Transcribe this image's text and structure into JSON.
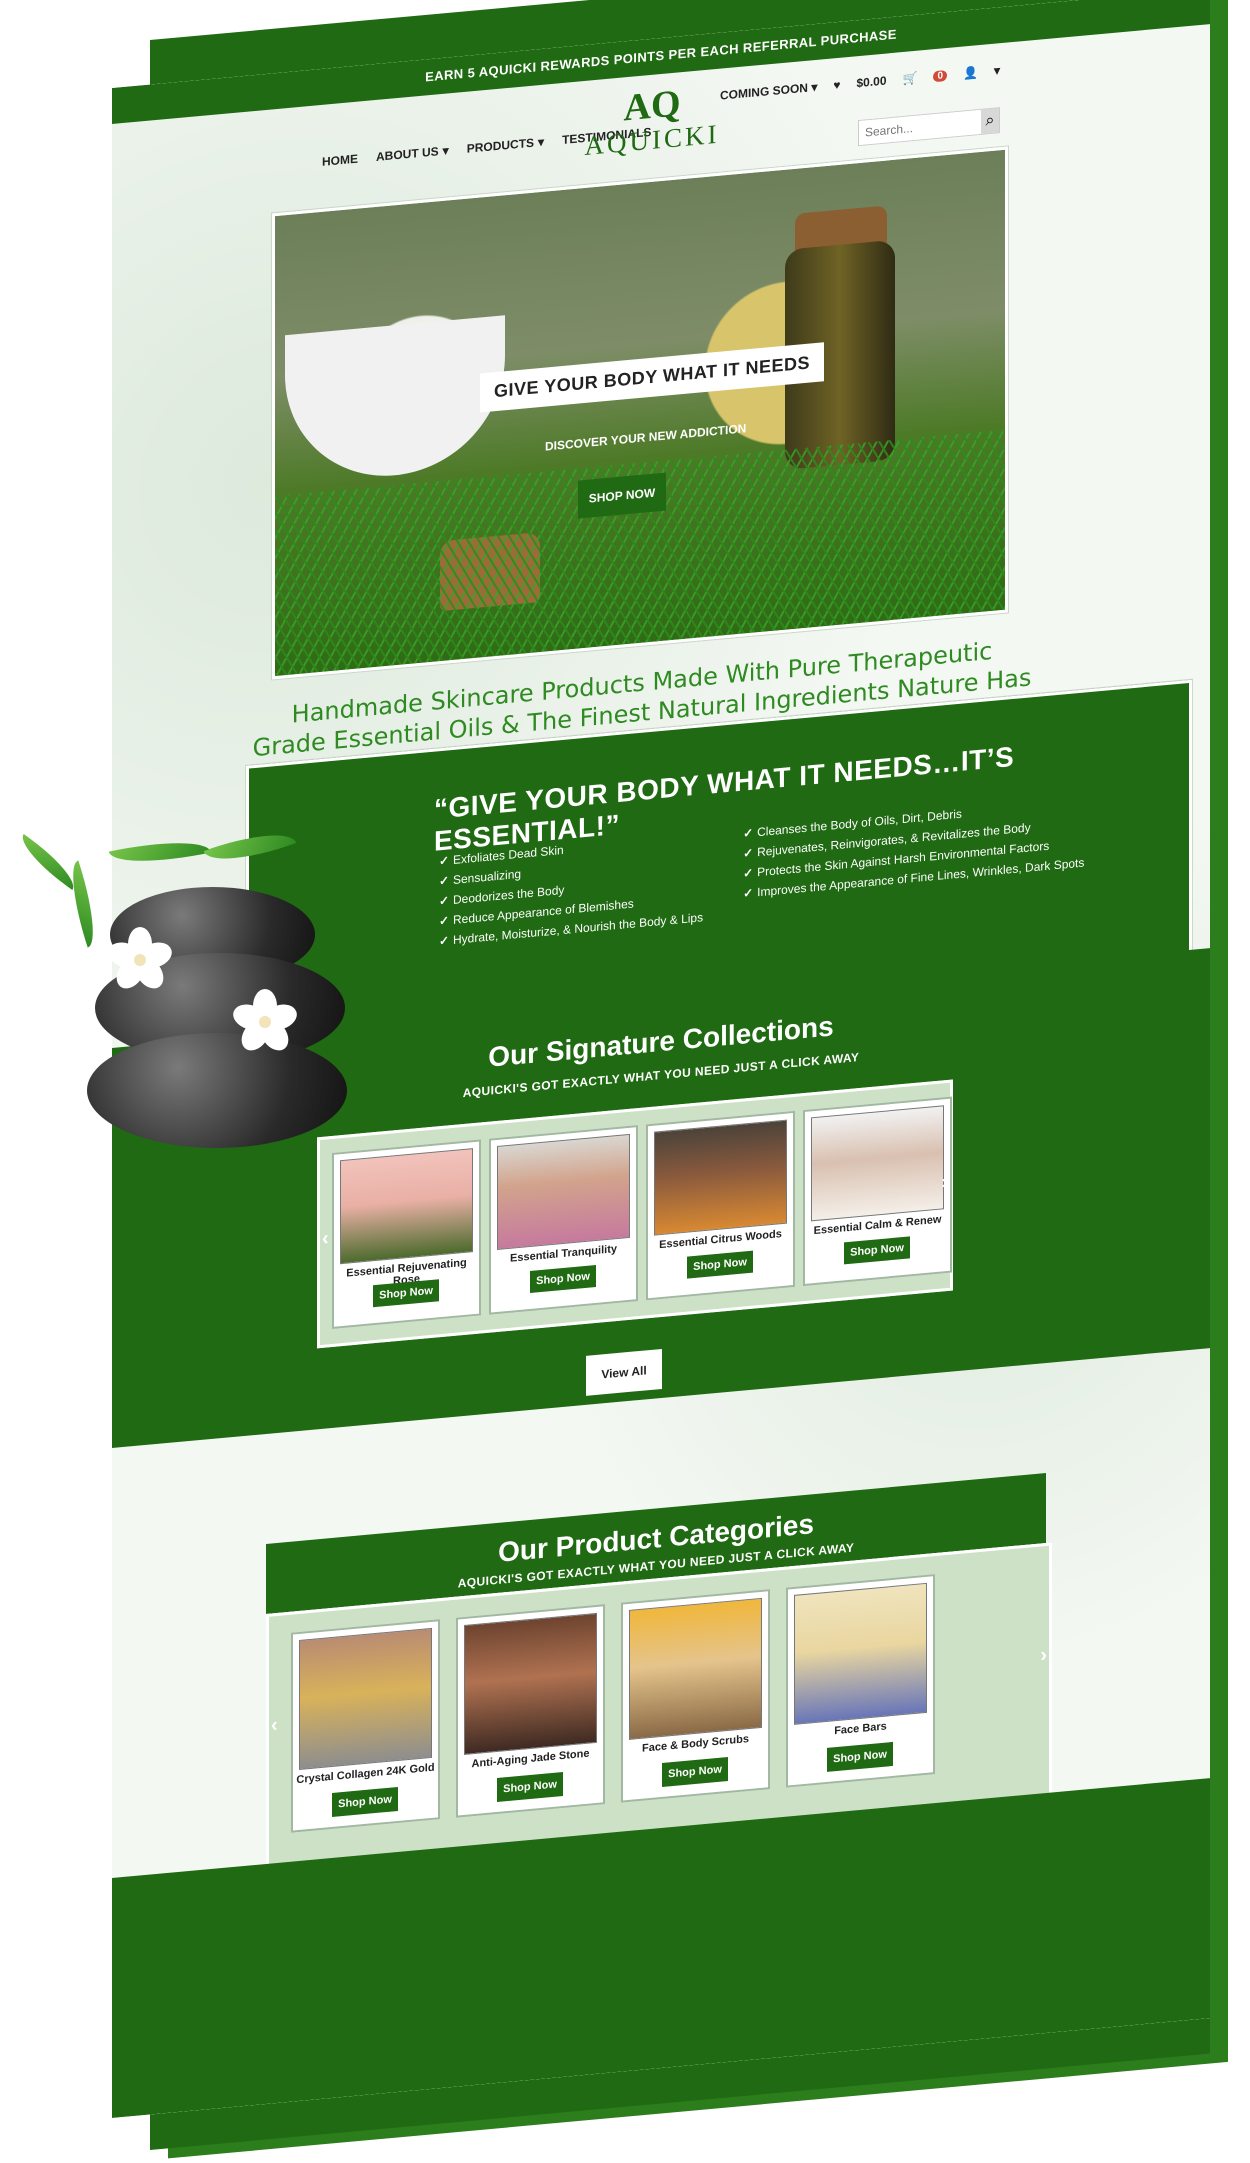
{
  "promo": {
    "text": "EARN 5 AQUICKI REWARDS POINTS PER EACH REFERRAL PURCHASE"
  },
  "nav": {
    "home": "HOME",
    "about": "ABOUT US",
    "products": "PRODUCTS",
    "testimonials": "TESTIMONIALS"
  },
  "logo": {
    "mark": "AQ",
    "text": "AQUICKI"
  },
  "tools": {
    "coming_soon": "COMING SOON",
    "cart_total": "$0.00",
    "cart_count": "0",
    "search_placeholder": "Search..."
  },
  "hero": {
    "title": "GIVE YOUR BODY WHAT IT NEEDS",
    "subtitle": "DISCOVER YOUR NEW ADDICTION",
    "button": "SHOP NOW"
  },
  "tagline": "Handmade Skincare Products Made With Pure Therapeutic Grade Essential Oils & The Finest Natural Ingredients Nature Has To Offer!",
  "essential": {
    "title": "“GIVE YOUR BODY WHAT IT NEEDS…IT’S ESSENTIAL!”",
    "left_items": [
      "Exfoliates Dead Skin",
      "Sensualizing",
      "Deodorizes the Body",
      "Reduce Appearance of Blemishes",
      "Hydrate, Moisturize, & Nourish the Body & Lips"
    ],
    "right_items": [
      "Cleanses the Body of Oils, Dirt, Debris",
      "Rejuvenates, Reinvigorates, & Revitalizes the Body",
      "Protects the Skin Against Harsh Environmental Factors",
      "Improves the Appearance of Fine Lines, Wrinkles, Dark Spots"
    ]
  },
  "collections": {
    "title": "Our Signature Collections",
    "subtitle": "AQUICKI'S GOT EXACTLY WHAT YOU NEED JUST A CLICK AWAY",
    "view_all": "View All",
    "items": [
      {
        "name": "Essential Rejuvenating Rose",
        "button": "Shop Now"
      },
      {
        "name": "Essential Tranquility",
        "button": "Shop Now"
      },
      {
        "name": "Essential Citrus Woods",
        "button": "Shop Now"
      },
      {
        "name": "Essential Calm & Renew",
        "button": "Shop Now"
      }
    ]
  },
  "categories": {
    "title": "Our Product Categories",
    "subtitle": "AQUICKI'S GOT EXACTLY WHAT YOU NEED JUST A CLICK AWAY",
    "items": [
      {
        "name": "Crystal Collagen 24K Gold",
        "button": "Shop Now"
      },
      {
        "name": "Anti-Aging Jade Stone",
        "button": "Shop Now"
      },
      {
        "name": "Face & Body Scrubs",
        "button": "Shop Now"
      },
      {
        "name": "Face Bars",
        "button": "Shop Now"
      }
    ]
  },
  "colors": {
    "brand_green": "#1f6a12",
    "accent_green": "#2e8a21",
    "light_panel": "#cde1c7"
  },
  "icons": {
    "heart": "heart-icon",
    "cart": "cart-icon",
    "user": "user-icon",
    "search": "search-icon",
    "chevron": "chevron-down-icon",
    "check": "check-icon",
    "arrow_left": "arrow-left-icon",
    "arrow_right": "arrow-right-icon"
  }
}
